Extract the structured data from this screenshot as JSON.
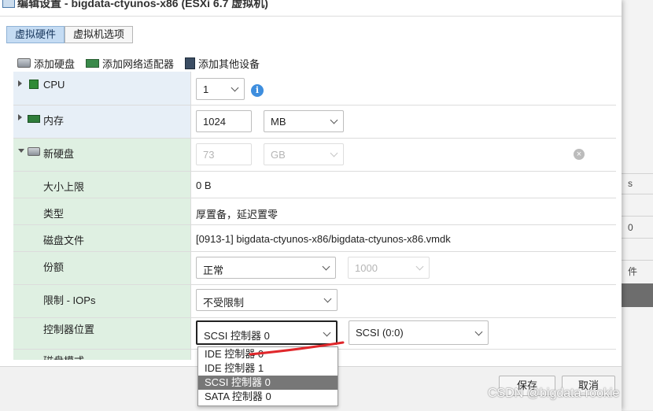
{
  "dialog": {
    "title": "编辑设置 - bigdata-ctyunos-x86 (ESXi 6.7 虚拟机)"
  },
  "tabs": [
    {
      "label": "虚拟硬件",
      "active": true
    },
    {
      "label": "虚拟机选项",
      "active": false
    }
  ],
  "toolbar": {
    "add_disk": "添加硬盘",
    "add_network": "添加网络适配器",
    "add_other": "添加其他设备"
  },
  "rows": {
    "cpu": {
      "label": "CPU",
      "value": "1"
    },
    "memory": {
      "label": "内存",
      "value": "1024",
      "unit": "MB"
    },
    "new_disk": {
      "label": "新硬盘",
      "value": "73",
      "unit": "GB"
    },
    "max_size": {
      "label": "大小上限",
      "value": "0 B"
    },
    "type": {
      "label": "类型",
      "value": "厚置备，延迟置零"
    },
    "disk_file": {
      "label": "磁盘文件",
      "value": "[0913-1] bigdata-ctyunos-x86/bigdata-ctyunos-x86.vmdk"
    },
    "shares": {
      "label": "份额",
      "value": "正常",
      "number": "1000"
    },
    "limit_iops": {
      "label": "限制 - IOPs",
      "value": "不受限制"
    },
    "controller": {
      "label": "控制器位置",
      "value": "SCSI 控制器 0",
      "node": "SCSI (0:0)"
    },
    "disk_mode": {
      "label": "磁盘模式"
    }
  },
  "controller_options": [
    {
      "label": "IDE 控制器 0",
      "selected": false
    },
    {
      "label": "IDE 控制器 1",
      "selected": false
    },
    {
      "label": "SCSI 控制器 0",
      "selected": true
    },
    {
      "label": "SATA 控制器 0",
      "selected": false
    }
  ],
  "footer": {
    "save": "保存",
    "cancel": "取消"
  },
  "background": {
    "frag1": "s",
    "frag2": "0",
    "frag3": "件"
  },
  "watermark": "CSDN @bigdata-rookie"
}
